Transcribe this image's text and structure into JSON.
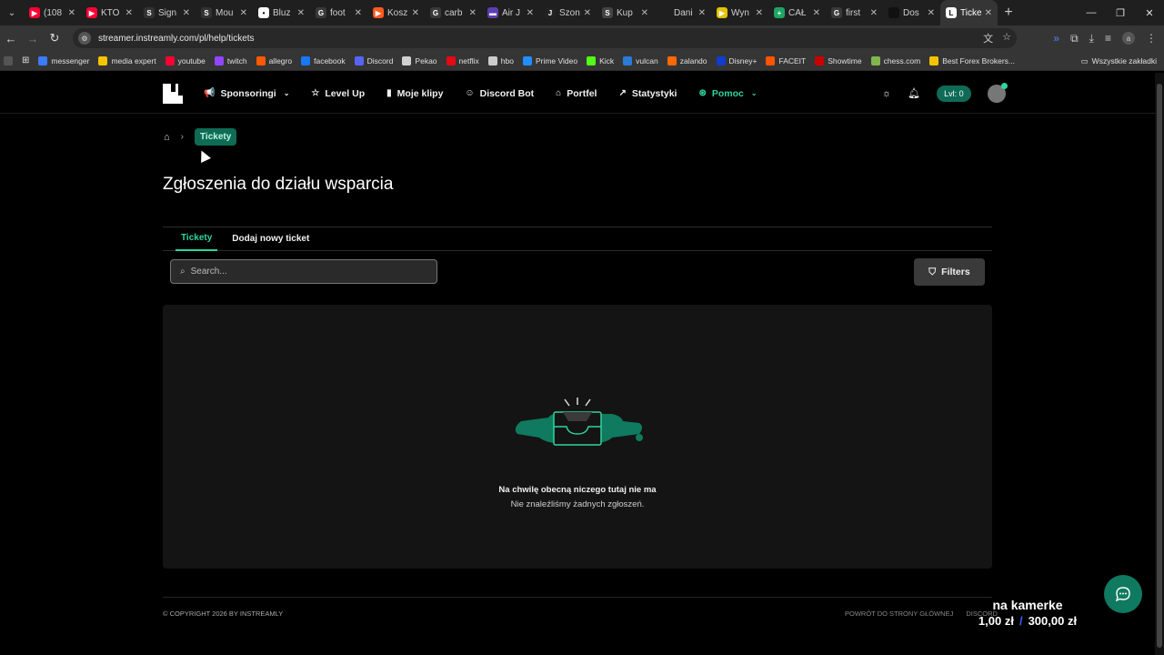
{
  "browser": {
    "tabs": [
      {
        "title": "(108",
        "color": "#ff0033",
        "glyph": "▶"
      },
      {
        "title": "KTO",
        "color": "#ff0033",
        "glyph": "▶"
      },
      {
        "title": "Sign",
        "color": "#333333",
        "glyph": "S"
      },
      {
        "title": "Mou",
        "color": "#333333",
        "glyph": "S"
      },
      {
        "title": "Bluz",
        "color": "#ffffff",
        "glyph": "•"
      },
      {
        "title": "foot",
        "color": "#3a3a3a",
        "glyph": "G"
      },
      {
        "title": "Kosz",
        "color": "#ff5a1f",
        "glyph": "▶"
      },
      {
        "title": "carb",
        "color": "#3a3a3a",
        "glyph": "G"
      },
      {
        "title": "Air J",
        "color": "#5b3fb0",
        "glyph": "▬"
      },
      {
        "title": "Szon",
        "color": "#222222",
        "glyph": "J"
      },
      {
        "title": "Kup",
        "color": "#444444",
        "glyph": "S"
      },
      {
        "title": "Dani",
        "color": "#1f1f1f",
        "glyph": ""
      },
      {
        "title": "Wyn",
        "color": "#e6c200",
        "glyph": "▶"
      },
      {
        "title": "CAŁ",
        "color": "#1fa463",
        "glyph": "+"
      },
      {
        "title": "first",
        "color": "#3a3a3a",
        "glyph": "G"
      },
      {
        "title": "Dos",
        "color": "#111111",
        "glyph": ""
      },
      {
        "title": "Ticke",
        "color": "#ffffff",
        "glyph": "L",
        "active": true
      }
    ],
    "url": "streamer.instreamly.com/pl/help/tickets",
    "profile_letter": "a",
    "bookmarks": [
      {
        "label": "messenger",
        "color": "#3a7bff"
      },
      {
        "label": "media expert",
        "color": "#f5c400"
      },
      {
        "label": "youtube",
        "color": "#ff0033"
      },
      {
        "label": "twitch",
        "color": "#9146ff"
      },
      {
        "label": "allegro",
        "color": "#ff5a00"
      },
      {
        "label": "facebook",
        "color": "#1877f2"
      },
      {
        "label": "Discord",
        "color": "#5865f2"
      },
      {
        "label": "Pekao",
        "color": "#d0d0d0"
      },
      {
        "label": "netflix",
        "color": "#e50914"
      },
      {
        "label": "hbo",
        "color": "#cccccc"
      },
      {
        "label": "Prime Video",
        "color": "#1f8fff"
      },
      {
        "label": "Kick",
        "color": "#53fc18"
      },
      {
        "label": "vulcan",
        "color": "#2a7bd6"
      },
      {
        "label": "zalando",
        "color": "#ff6900"
      },
      {
        "label": "Disney+",
        "color": "#113ccf"
      },
      {
        "label": "FACEIT",
        "color": "#ff5500"
      },
      {
        "label": "Showtime",
        "color": "#cc0000"
      },
      {
        "label": "chess.com",
        "color": "#81b64c"
      },
      {
        "label": "Best Forex Brokers...",
        "color": "#f5c400"
      }
    ],
    "bookmarks_folder": "Wszystkie zakładki"
  },
  "nav": {
    "items": [
      {
        "label": "Sponsoringi",
        "icon": "megaphone-icon",
        "glyph": "📢",
        "dropdown": true
      },
      {
        "label": "Level Up",
        "icon": "star-icon",
        "glyph": "☆"
      },
      {
        "label": "Moje klipy",
        "icon": "clip-icon",
        "glyph": "▮"
      },
      {
        "label": "Discord Bot",
        "icon": "discord-icon",
        "glyph": "☺"
      },
      {
        "label": "Portfel",
        "icon": "wallet-icon",
        "glyph": "⌂"
      },
      {
        "label": "Statystyki",
        "icon": "chart-icon",
        "glyph": "↗"
      },
      {
        "label": "Pomoc",
        "icon": "help-icon",
        "glyph": "⊛",
        "dropdown": true,
        "active": true
      }
    ],
    "level_badge": "Lvl: 0"
  },
  "breadcrumb": {
    "current": "Tickety"
  },
  "page": {
    "title": "Zgłoszenia do działu wsparcia",
    "tabs": [
      "Tickety",
      "Dodaj nowy ticket"
    ],
    "search_placeholder": "Search...",
    "filters_label": "Filters",
    "empty_title": "Na chwilę obecną niczego tutaj nie ma",
    "empty_subtitle": "Nie znaleźliśmy żadnych zgłoszeń."
  },
  "footer": {
    "copyright": "© COPYRIGHT 2026 BY INSTREAMLY",
    "links": [
      "POWRÓT DO STRONY GŁÓWNEJ",
      "DISCORD"
    ]
  },
  "overlay": {
    "line1": "na kamerke",
    "amount": "1,00 zł",
    "sep": "/",
    "goal": "300,00 zł"
  },
  "colors": {
    "accent": "#2fd4a0",
    "accent_dark": "#0f6b55"
  }
}
